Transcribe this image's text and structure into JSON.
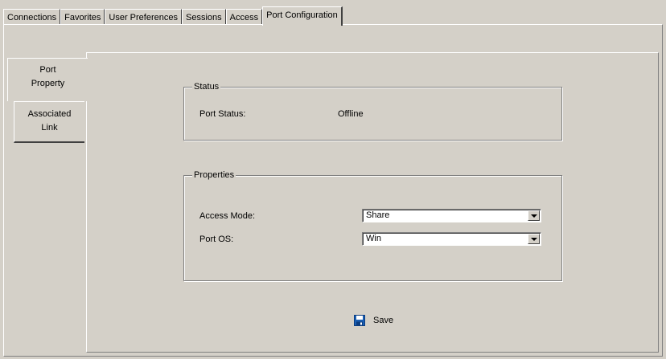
{
  "top_tabs": [
    {
      "label": "Connections",
      "active": false
    },
    {
      "label": "Favorites",
      "active": false
    },
    {
      "label": "User Preferences",
      "active": false
    },
    {
      "label": "Sessions",
      "active": false
    },
    {
      "label": "Access",
      "active": false
    },
    {
      "label": "Port Configuration",
      "active": true
    }
  ],
  "side_tabs": [
    {
      "line1": "Port",
      "line2": "Property",
      "active": true
    },
    {
      "line1": "Associated",
      "line2": "Link",
      "active": false
    }
  ],
  "status_group": {
    "legend": "Status",
    "port_status_label": "Port Status:",
    "port_status_value": "Offline"
  },
  "properties_group": {
    "legend": "Properties",
    "access_mode_label": "Access Mode:",
    "access_mode_value": "Share",
    "port_os_label": "Port OS:",
    "port_os_value": "Win"
  },
  "actions": {
    "save_label": "Save",
    "save_icon": "floppy-disk-icon"
  },
  "colors": {
    "background": "#d4d0c8",
    "save_icon_blue": "#1a5fb4"
  }
}
